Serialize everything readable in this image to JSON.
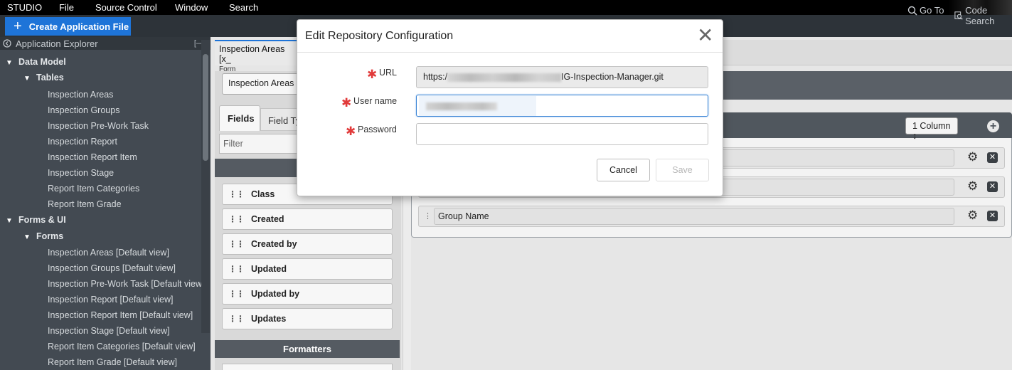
{
  "menubar": {
    "studio": "STUDIO",
    "items": [
      "File",
      "Source Control",
      "Window",
      "Search"
    ]
  },
  "toolbar": {
    "create_label": "Create Application File",
    "goto_label": "Go To",
    "code_search_label": "Code Search"
  },
  "explorer": {
    "title": "Application Explorer",
    "collapse_label": "[—]",
    "data_model": "Data Model",
    "tables": "Tables",
    "table_items": [
      "Inspection Areas",
      "Inspection Groups",
      "Inspection Pre-Work Task",
      "Inspection Report",
      "Inspection Report Item",
      "Inspection Stage",
      "Report Item Categories",
      "Report Item Grade"
    ],
    "forms_ui": "Forms & UI",
    "forms": "Forms",
    "form_items": [
      "Inspection Areas [Default view]",
      "Inspection Groups [Default view]",
      "Inspection Pre-Work Task [Default view]",
      "Inspection Report [Default view]",
      "Inspection Report Item [Default view]",
      "Inspection Stage [Default view]",
      "Report Item Categories [Default view]",
      "Report Item Grade [Default view]"
    ]
  },
  "editor": {
    "tab_title": "Inspection Areas [x_",
    "tab_sub": "Form",
    "table_select": "Inspection Areas [",
    "fields_tab": "Fields",
    "field_types_tab": "Field Ty",
    "filter_placeholder": "Filter",
    "palette_fields": [
      "Class",
      "Created",
      "Created by",
      "Updated",
      "Updated by",
      "Updates"
    ],
    "formatters_label": "Formatters",
    "columns_select": "1 Column ↕",
    "rows": [
      "",
      "",
      "Group Name"
    ]
  },
  "modal": {
    "title": "Edit Repository Configuration",
    "close_glyph": "✕",
    "url_label": "URL",
    "url_prefix": "https:/",
    "url_suffix": "IG-Inspection-Manager.git",
    "username_label": "User name",
    "username_value": "",
    "password_label": "Password",
    "password_value": "",
    "cancel_label": "Cancel",
    "save_label": "Save"
  },
  "colors": {
    "accent": "#1e74d8",
    "required": "#e13a3a",
    "explorer_bg": "#434a52",
    "toolbar_bg": "#2d3339"
  }
}
